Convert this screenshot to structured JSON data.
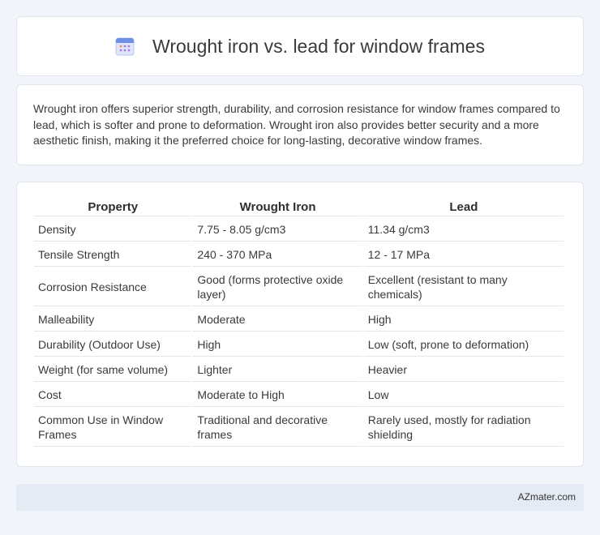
{
  "header": {
    "title": "Wrought iron vs. lead for window frames",
    "icon": "calendar-icon",
    "icon_color": "#6e8ee8"
  },
  "summary": "Wrought iron offers superior strength, durability, and corrosion resistance for window frames compared to lead, which is softer and prone to deformation. Wrought iron also provides better security and a more aesthetic finish, making it the preferred choice for long-lasting, decorative window frames.",
  "table": {
    "headers": [
      "Property",
      "Wrought Iron",
      "Lead"
    ],
    "rows": [
      [
        "Density",
        "7.75 - 8.05 g/cm3",
        "11.34 g/cm3"
      ],
      [
        "Tensile Strength",
        "240 - 370 MPa",
        "12 - 17 MPa"
      ],
      [
        "Corrosion Resistance",
        "Good (forms protective oxide layer)",
        "Excellent (resistant to many chemicals)"
      ],
      [
        "Malleability",
        "Moderate",
        "High"
      ],
      [
        "Durability (Outdoor Use)",
        "High",
        "Low (soft, prone to deformation)"
      ],
      [
        "Weight (for same volume)",
        "Lighter",
        "Heavier"
      ],
      [
        "Cost",
        "Moderate to High",
        "Low"
      ],
      [
        "Common Use in Window Frames",
        "Traditional and decorative frames",
        "Rarely used, mostly for radiation shielding"
      ]
    ]
  },
  "footer": {
    "brand": "AZmater.com",
    "background": "#e5ebf5"
  }
}
